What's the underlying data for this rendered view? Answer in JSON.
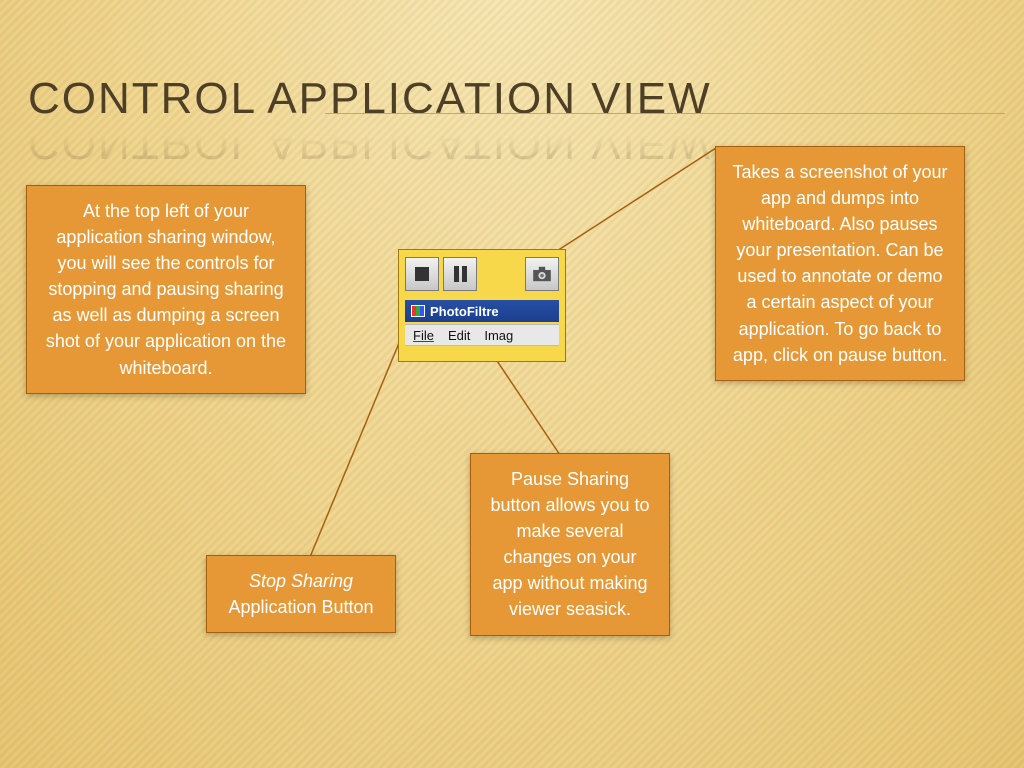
{
  "title": "CONTROL APPLICATION  VIEW",
  "callouts": {
    "intro": "At the top left of your application sharing window, you will see the controls for stopping and pausing sharing as well as dumping a screen shot of your application on the whiteboard.",
    "stop_italic": "Stop Sharing",
    "stop_rest": "Application Button",
    "pause": "Pause Sharing button allows you to make several changes on your app without making viewer seasick.",
    "screenshot": "Takes a screenshot of your app and dumps into whiteboard.  Also pauses your presentation. Can be used to annotate or demo a certain aspect of your application. To go back to app, click on pause button."
  },
  "appshot": {
    "app_name": "PhotoFiltre",
    "menu1": "File",
    "menu2": "Edit",
    "menu3": "Imag"
  }
}
